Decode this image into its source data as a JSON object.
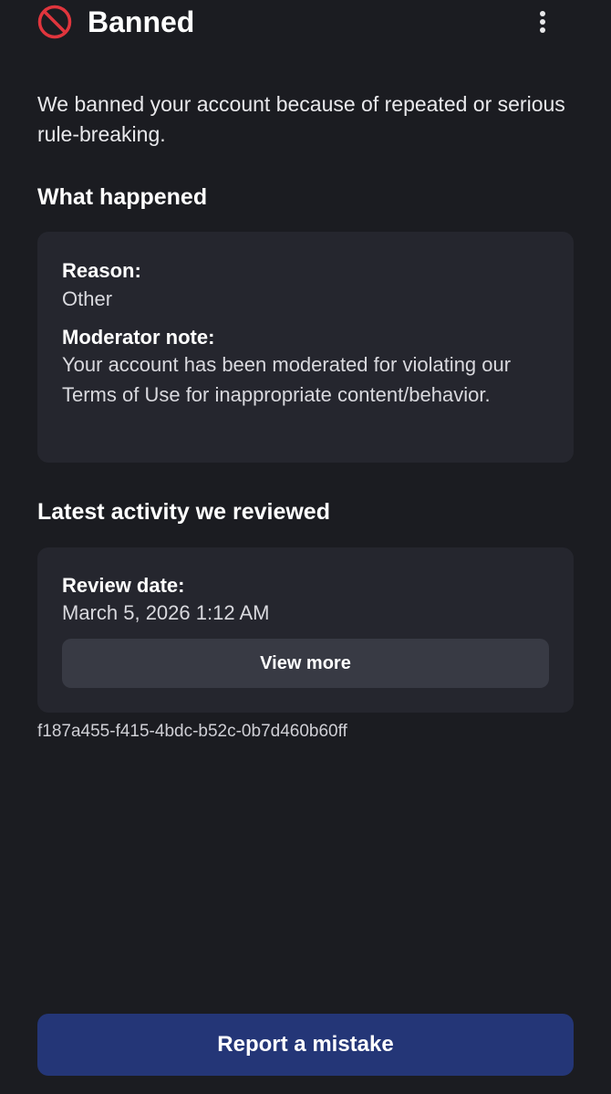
{
  "header": {
    "title": "Banned",
    "status_icon": "ban-icon",
    "menu_icon": "more-vertical-icon"
  },
  "intro": "We banned your account because of repeated or serious rule-breaking.",
  "what_happened": {
    "heading": "What happened",
    "reason_label": "Reason:",
    "reason_value": "Other",
    "note_label": "Moderator note:",
    "note_value": "Your account has been moderated for violating our Terms of Use for inappropriate content/behavior."
  },
  "latest_activity": {
    "heading": "Latest activity we reviewed",
    "review_date_label": "Review date:",
    "review_date_value": "March 5, 2026 1:12 AM",
    "view_more_label": "View more"
  },
  "reference_id": "f187a455-f415-4bdc-b52c-0b7d460b60ff",
  "footer": {
    "report_label": "Report a mistake"
  },
  "colors": {
    "background": "#1b1c21",
    "card": "#25262e",
    "ban_red": "#e0353d",
    "report_button": "#243677",
    "secondary_button": "#383a44"
  }
}
